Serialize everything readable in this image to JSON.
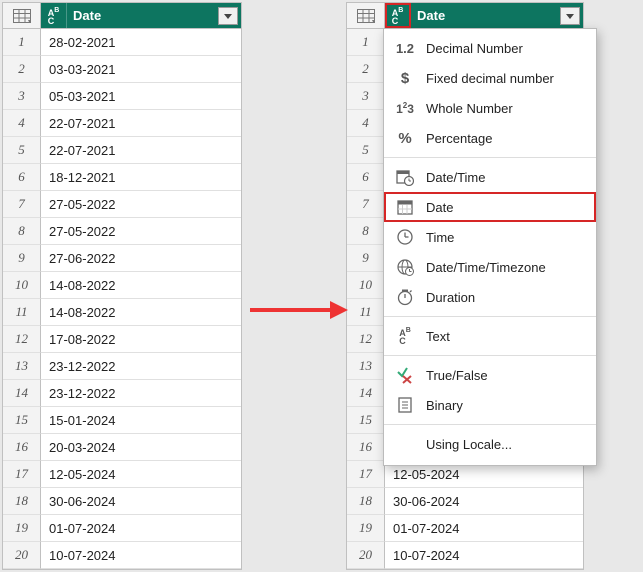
{
  "column_header": "Date",
  "type_glyph_top": "A",
  "type_glyph_bottom": "C",
  "type_glyph_sup": "B",
  "rows": [
    "28-02-2021",
    "03-03-2021",
    "05-03-2021",
    "22-07-2021",
    "22-07-2021",
    "18-12-2021",
    "27-05-2022",
    "27-05-2022",
    "27-06-2022",
    "14-08-2022",
    "14-08-2022",
    "17-08-2022",
    "23-12-2022",
    "23-12-2022",
    "15-01-2024",
    "20-03-2024",
    "12-05-2024",
    "30-06-2024",
    "01-07-2024",
    "10-07-2024"
  ],
  "menu": {
    "items": [
      {
        "icon": "decimal",
        "label": "Decimal Number"
      },
      {
        "icon": "dollar",
        "label": "Fixed decimal number"
      },
      {
        "icon": "whole",
        "label": "Whole Number"
      },
      {
        "icon": "percent",
        "label": "Percentage"
      },
      {
        "icon": "datetime",
        "label": "Date/Time"
      },
      {
        "icon": "date",
        "label": "Date",
        "highlight": true
      },
      {
        "icon": "time",
        "label": "Time"
      },
      {
        "icon": "tz",
        "label": "Date/Time/Timezone"
      },
      {
        "icon": "duration",
        "label": "Duration"
      },
      {
        "icon": "text",
        "label": "Text"
      },
      {
        "icon": "bool",
        "label": "True/False"
      },
      {
        "icon": "binary",
        "label": "Binary"
      },
      {
        "icon": "",
        "label": "Using Locale..."
      }
    ]
  },
  "right_visible_rows_start": 15
}
